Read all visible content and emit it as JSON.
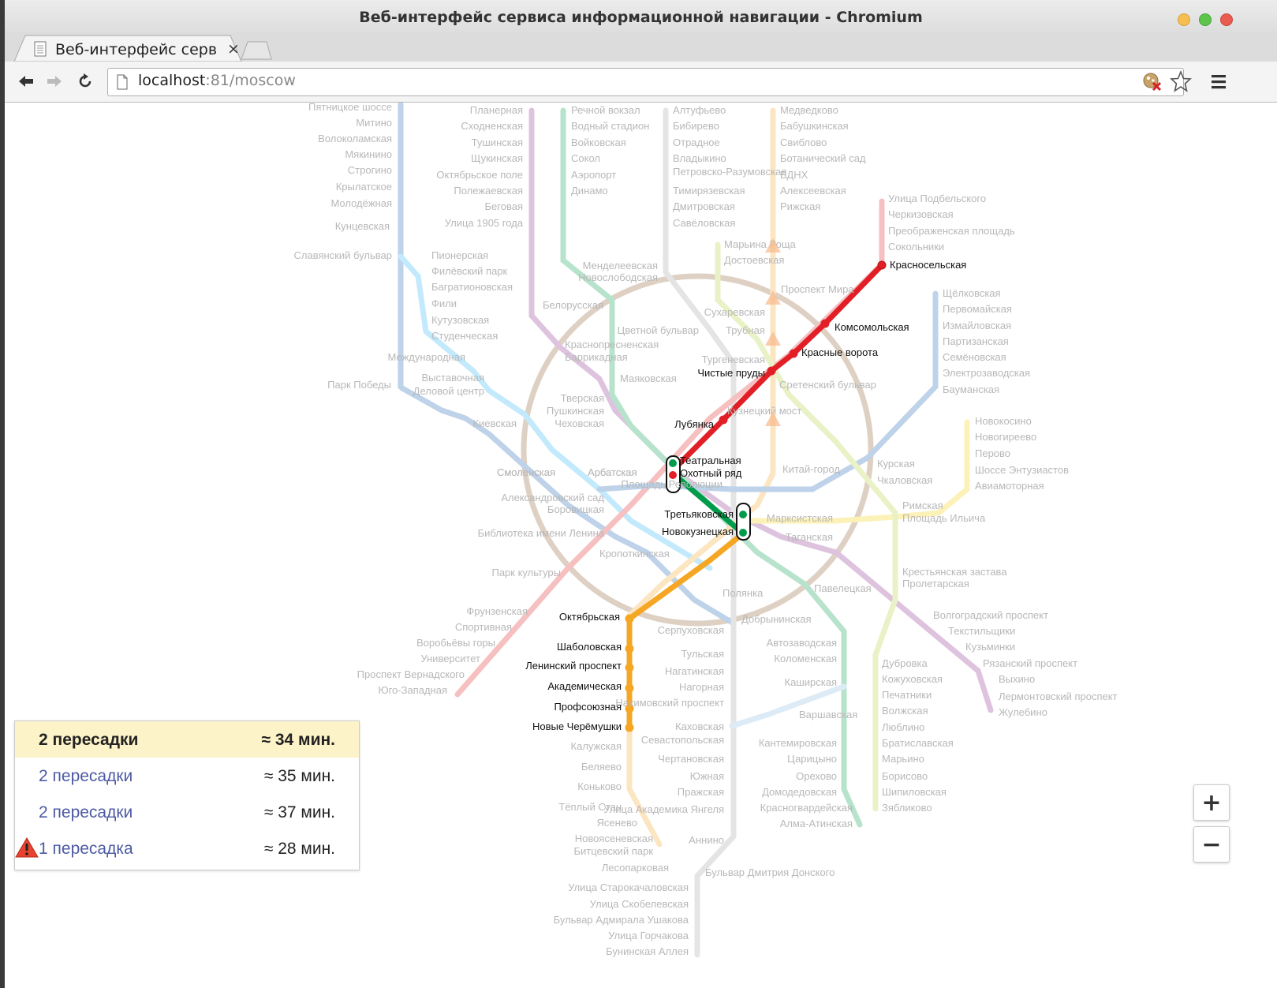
{
  "window": {
    "title": "Веб-интерфейс сервиса информационной навигации - Chromium",
    "tab_title": "Веб-интерфейс сервис",
    "tab_close": "×",
    "url_host": "localhost",
    "url_port": ":81",
    "url_path": "/moscow",
    "colors": {
      "close": "#e95c4f",
      "minimize": "#f5be4f",
      "maximize": "#5ec44c"
    }
  },
  "routes": [
    {
      "label": "2 пересадки",
      "time": "≈ 34 мин.",
      "selected": true
    },
    {
      "label": "2 пересадки",
      "time": "≈ 35 мин."
    },
    {
      "label": "2 пересадки",
      "time": "≈ 37 мин."
    },
    {
      "label": "1 пересадка",
      "time": "≈ 28 мин.",
      "warning": true
    }
  ],
  "zoom": {
    "in": "+",
    "out": "−"
  },
  "map": {
    "line_colors": {
      "red": "#e21f26",
      "green": "#009c4b",
      "orange": "#f5a623",
      "purple": "#8b2c8f",
      "dark_blue": "#1a5fb4",
      "light_blue": "#29b6f6",
      "brown": "#8b5a2b",
      "grey": "#a0a0a0",
      "yellow": "#f5d000",
      "lime": "#b3d335",
      "teal": "#4fc3a1",
      "pale_blue": "#85b8de"
    },
    "route_stations": [
      "Красносельская",
      "Комсомольская",
      "Красные ворота",
      "Чистые пруды",
      "Лубянка",
      "Театральная",
      "Охотный ряд",
      "Третьяковская",
      "Новокузнецкая",
      "Октябрьская",
      "Шаболовская",
      "Ленинский проспект",
      "Академическая",
      "Профсоюзная",
      "Новые Черёмушки"
    ],
    "faded_stations": [
      "Пятницкое шоссе",
      "Митино",
      "Волоколамская",
      "Мякинино",
      "Строгино",
      "Крылатское",
      "Молодёжная",
      "Кунцевская",
      "Славянский бульвар",
      "Пионерская",
      "Филёвский парк",
      "Багратионовская",
      "Фили",
      "Кутузовская",
      "Студенческая",
      "Международная",
      "Выставочная",
      "Деловой центр",
      "Парк Победы",
      "Киевская",
      "Смоленская",
      "Арбатская",
      "Александровский сад",
      "Боровицкая",
      "Библиотека имени Ленина",
      "Кропоткинская",
      "Парк культуры",
      "Фрунзенская",
      "Спортивная",
      "Воробьёвы горы",
      "Университет",
      "Проспект Вернадского",
      "Юго-Западная",
      "Планерная",
      "Сходненская",
      "Тушинская",
      "Щукинская",
      "Октябрьское поле",
      "Полежаевская",
      "Беговая",
      "Улица 1905 года",
      "Белорусская",
      "Краснопресненская",
      "Баррикадная",
      "Маяковская",
      "Тверская",
      "Пушкинская",
      "Чеховская",
      "Речной вокзал",
      "Водный стадион",
      "Войковская",
      "Сокол",
      "Аэропорт",
      "Динамо",
      "Менделеевская",
      "Новослободская",
      "Цветной бульвар",
      "Трубная",
      "Сухаревская",
      "Тургеневская",
      "Сретенский бульвар",
      "Кузнецкий мост",
      "Китай-город",
      "Площадь Революции",
      "Алтуфьево",
      "Бибирево",
      "Отрадное",
      "Владыкино",
      "Петровско-Разумовская",
      "Тимирязевская",
      "Дмитровская",
      "Савёловская",
      "Медведково",
      "Бабушкинская",
      "Свиблово",
      "Ботанический сад",
      "ВДНХ",
      "Алексеевская",
      "Рижская",
      "Проспект Мира",
      "Марьина Роща",
      "Достоевская",
      "Улица Подбельского",
      "Черкизовская",
      "Преображенская площадь",
      "Сокольники",
      "Щёлковская",
      "Первомайская",
      "Измайловская",
      "Партизанская",
      "Семёновская",
      "Электрозаводская",
      "Бауманская",
      "Курская",
      "Чкаловская",
      "Новокосино",
      "Новогиреево",
      "Перово",
      "Шоссе Энтузиастов",
      "Авиамоторная",
      "Римская",
      "Площадь Ильича",
      "Марксистская",
      "Таганская",
      "Крестьянская застава",
      "Пролетарская",
      "Волгоградский проспект",
      "Текстильщики",
      "Кузьминки",
      "Рязанский проспект",
      "Выхино",
      "Лермонтовский проспект",
      "Жулебино",
      "Павелецкая",
      "Полянка",
      "Добрынинская",
      "Серпуховская",
      "Тульская",
      "Нагатинская",
      "Нагорная",
      "Нахимовский проспект",
      "Севастопольская",
      "Каховская",
      "Чертановская",
      "Южная",
      "Пражская",
      "Улица Академика Янгеля",
      "Аннино",
      "Автозаводская",
      "Коломенская",
      "Каширская",
      "Варшавская",
      "Кантемировская",
      "Царицыно",
      "Орехово",
      "Домодедовская",
      "Красногвардейская",
      "Зябликово",
      "Алма-Атинская",
      "Дубровка",
      "Кожуховская",
      "Печатники",
      "Волжская",
      "Люблино",
      "Братиславская",
      "Марьино",
      "Борисово",
      "Шипиловская",
      "Калужская",
      "Беляево",
      "Коньково",
      "Тёплый Стан",
      "Ясенево",
      "Новоясеневская",
      "Битцевский парк",
      "Лесопарковая",
      "Бульвар Дмитрия Донского",
      "Улица Старокачаловская",
      "Улица Скобелевская",
      "Бульвар Адмирала Ушакова",
      "Улица Горчакова",
      "Бунинская Аллея",
      "Смоленская",
      "Арбатская"
    ]
  }
}
